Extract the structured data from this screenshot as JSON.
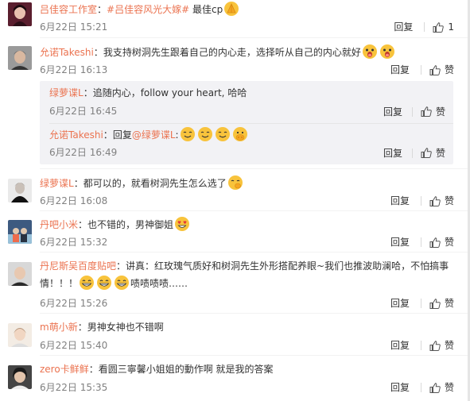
{
  "comments": [
    {
      "user": "吕佳容工作室",
      "sep": "：",
      "hashtag": "#吕佳容风光大嫁#",
      "text": " 最佳cp",
      "time": "6月22日 15:21",
      "reply_label": "回复",
      "like_label": "1"
    },
    {
      "user": "允诺Takeshi",
      "sep": "：",
      "text": "我支持树洞先生跟着自己的内心走，选择听从自己的内心就好",
      "time": "6月22日 16:13",
      "reply_label": "回复",
      "like_label": "赞",
      "replies": [
        {
          "user": "绿萝谍L",
          "sep": "：",
          "text": "追随内心，follow your heart, 哈哈",
          "time": "6月22日 16:45",
          "reply_label": "回复",
          "like_label": "赞"
        },
        {
          "user": "允诺Takeshi",
          "sep": "：",
          "text_prefix": "回复",
          "mention": "@绿萝谍L",
          "text": ":",
          "time": "6月22日 16:49",
          "reply_label": "回复",
          "like_label": "赞"
        }
      ]
    },
    {
      "user": "绿萝谍L",
      "sep": "：",
      "text": "都可以的，就看树洞先生怎么选了",
      "time": "6月22日 16:08",
      "reply_label": "回复",
      "like_label": "赞"
    },
    {
      "user": "丹吧小米",
      "sep": "：",
      "text": "也不错的，男神御姐",
      "time": "6月22日 15:32",
      "reply_label": "回复",
      "like_label": "赞"
    },
    {
      "user": "丹尼斯吴百度贴吧",
      "sep": "：",
      "text": "讲真：红玫瑰气质好和树洞先生外形搭配养眼~我们也推波助澜哈，不怕搞事",
      "text_line2_a": "情！！！",
      "text_line2_b": "啧啧啧啧……",
      "time": "6月22日 15:26",
      "reply_label": "回复",
      "like_label": "赞"
    },
    {
      "user": "m萌小新",
      "sep": "：",
      "text": "男神女神也不错啊",
      "time": "6月22日 15:40",
      "reply_label": "回复",
      "like_label": "赞"
    },
    {
      "user": "zero卡鲜鲜",
      "sep": "：",
      "text": "看圆三寧馨小姐姐的動作啊 就是我的答案",
      "time": "6月22日 15:35",
      "reply_label": "回复",
      "like_label": "赞"
    }
  ],
  "colors": {
    "username": "#eb7350",
    "text": "#333333",
    "meta": "#808080",
    "nested_bg": "#f2f2f5"
  },
  "icons": [
    "like-thumb-icon",
    "emoji-pray-icon",
    "emoji-shock-icon",
    "emoji-smile-icon",
    "emoji-heart-eyes-icon",
    "emoji-grin-icon",
    "emoji-shy-icon",
    "emoji-lol-icon"
  ]
}
